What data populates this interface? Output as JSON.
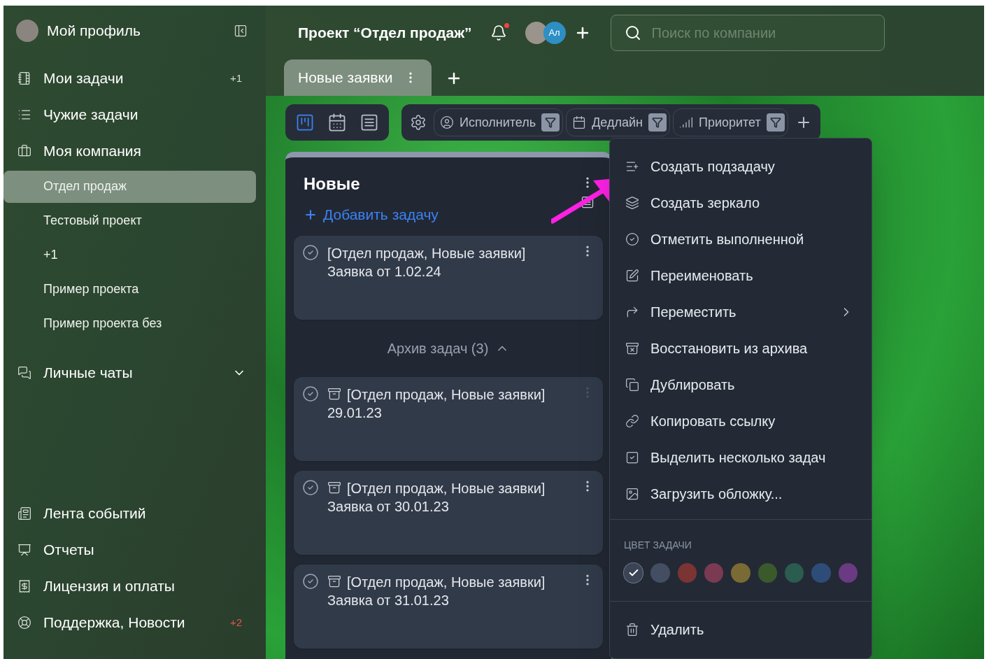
{
  "sidebar": {
    "profile": {
      "label": "Мой профиль"
    },
    "items": [
      {
        "kind": "section",
        "label": "Мои задачи",
        "badge": "+1",
        "selected": false
      },
      {
        "kind": "section",
        "label": "Чужие задачи",
        "selected": false
      },
      {
        "kind": "section",
        "label": "Моя компания",
        "selected": false
      },
      {
        "kind": "project",
        "label": "Отдел продаж",
        "selected": true
      },
      {
        "kind": "project",
        "label": "Тестовый проект",
        "selected": false
      },
      {
        "kind": "project",
        "label": "+1",
        "selected": false
      },
      {
        "kind": "project",
        "label": "Пример проекта",
        "selected": false
      },
      {
        "kind": "project",
        "label": "Пример проекта без",
        "selected": false
      },
      {
        "kind": "group",
        "label": "Личные чаты",
        "expanded": false,
        "selected": false
      }
    ],
    "bottom_items": [
      {
        "label": "Лента событий"
      },
      {
        "label": "Отчеты"
      },
      {
        "label": "Лицензия и оплаты"
      },
      {
        "label": "Поддержка, Новости",
        "badge": "+2"
      }
    ]
  },
  "header": {
    "title": "Проект “Отдел продаж”",
    "notification": true,
    "avatar_initials": "Ал",
    "search": {
      "placeholder": "Поиск по компании"
    }
  },
  "tabs": [
    {
      "label": "Новые заявки",
      "selected": true
    }
  ],
  "views": [
    {
      "selected": true
    },
    {
      "selected": false
    },
    {
      "selected": false
    }
  ],
  "filters": [
    {
      "label": "Исполнитель"
    },
    {
      "label": "Дедлайн"
    },
    {
      "label": "Приоритет"
    }
  ],
  "column": {
    "title": "Новые",
    "add_task": "Добавить задачу",
    "tasks": [
      {
        "title": "[Отдел продаж, Новые заявки] Заявка от 1.02.24",
        "archived": false
      }
    ],
    "archive": {
      "label": "Архив задач (3)",
      "expanded": true
    },
    "archived_tasks": [
      {
        "title": "[Отдел продаж, Новые заявки] 29.01.23",
        "archived": true,
        "menu_dim": true
      },
      {
        "title": "[Отдел продаж, Новые заявки] Заявка от 30.01.23",
        "archived": true,
        "menu_dim": false
      },
      {
        "title": "[Отдел продаж, Новые заявки] Заявка от 31.01.23",
        "archived": true,
        "menu_dim": false
      }
    ]
  },
  "context_menu": {
    "items": [
      {
        "label": "Создать подзадачу",
        "submenu": false
      },
      {
        "label": "Создать зеркало",
        "submenu": false
      },
      {
        "label": "Отметить выполненной",
        "submenu": false
      },
      {
        "label": "Переименовать",
        "submenu": false
      },
      {
        "label": "Переместить",
        "submenu": true
      },
      {
        "label": "Восстановить из архива",
        "submenu": false
      },
      {
        "label": "Дублировать",
        "submenu": false
      },
      {
        "label": "Копировать ссылку",
        "submenu": false
      },
      {
        "label": "Выделить несколько задач",
        "submenu": false
      },
      {
        "label": "Загрузить обложку...",
        "submenu": false
      }
    ],
    "color_title": "ЦВЕТ ЗАДАЧИ",
    "colors": [
      {
        "color": "#3b4454",
        "selected": true
      },
      {
        "color": "#434e62",
        "selected": false
      },
      {
        "color": "#7a3434",
        "selected": false
      },
      {
        "color": "#7a3a52",
        "selected": false
      },
      {
        "color": "#7a6a34",
        "selected": false
      },
      {
        "color": "#3a5a2c",
        "selected": false
      },
      {
        "color": "#2a5c50",
        "selected": false
      },
      {
        "color": "#2e4c78",
        "selected": false
      },
      {
        "color": "#6a3a82",
        "selected": false
      }
    ],
    "delete": {
      "label": "Удалить"
    }
  }
}
